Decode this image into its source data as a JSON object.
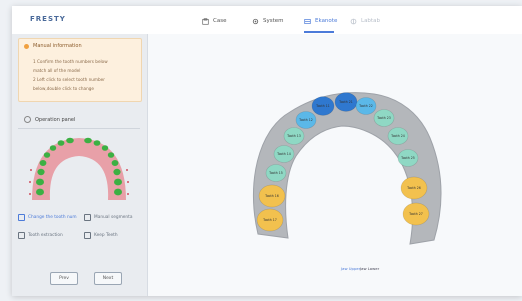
{
  "app": {
    "logo": "FRESTY"
  },
  "nav": {
    "items": [
      {
        "label": "Case",
        "icon": "case-icon"
      },
      {
        "label": "System",
        "icon": "gear-icon"
      },
      {
        "label": "Ekanote",
        "icon": "scan-icon",
        "active": true
      },
      {
        "label": "Labtab",
        "icon": "lab-icon",
        "disabled": true
      }
    ]
  },
  "notice": {
    "title": "Manual information",
    "lines": [
      "1 Confirm the tooth numbers below",
      "match all of the model",
      "2 Left click to select tooth number",
      "below,double click to change"
    ]
  },
  "operation_panel": {
    "title": "Operation panel"
  },
  "actions": {
    "change_tooth": "Change the tooth num",
    "manual_segment": "Manual segmenta",
    "tooth_extraction": "Tooth extraction",
    "keep_teeth": "Keep Teeth"
  },
  "buttons": {
    "prev": "Prev",
    "next": "Next"
  },
  "viewport": {
    "controls": [
      "Jaw Upper",
      "Jaw Lower"
    ],
    "teeth": [
      {
        "label": "Tooth 17",
        "color": "#f2c14e"
      },
      {
        "label": "Tooth 16",
        "color": "#f2c14e"
      },
      {
        "label": "Tooth 15",
        "color": "#8fd8c4"
      },
      {
        "label": "Tooth 14",
        "color": "#8fd8c4"
      },
      {
        "label": "Tooth 13",
        "color": "#8fd8c4"
      },
      {
        "label": "Tooth 12",
        "color": "#5bb8e8"
      },
      {
        "label": "Tooth 11",
        "color": "#2f78cf"
      },
      {
        "label": "Tooth 21",
        "color": "#2f78cf"
      },
      {
        "label": "Tooth 22",
        "color": "#5bb8e8"
      },
      {
        "label": "Tooth 23",
        "color": "#8fd8c4"
      },
      {
        "label": "Tooth 24",
        "color": "#8fd8c4"
      },
      {
        "label": "Tooth 25",
        "color": "#8fd8c4"
      },
      {
        "label": "Tooth 26",
        "color": "#f2c14e"
      },
      {
        "label": "Tooth 27",
        "color": "#f2c14e"
      }
    ]
  },
  "colors": {
    "accent": "#4c7bd9",
    "notice_bg": "#fdf0de",
    "gum": "#e8a0a8",
    "tooth_green": "#3cb043"
  }
}
